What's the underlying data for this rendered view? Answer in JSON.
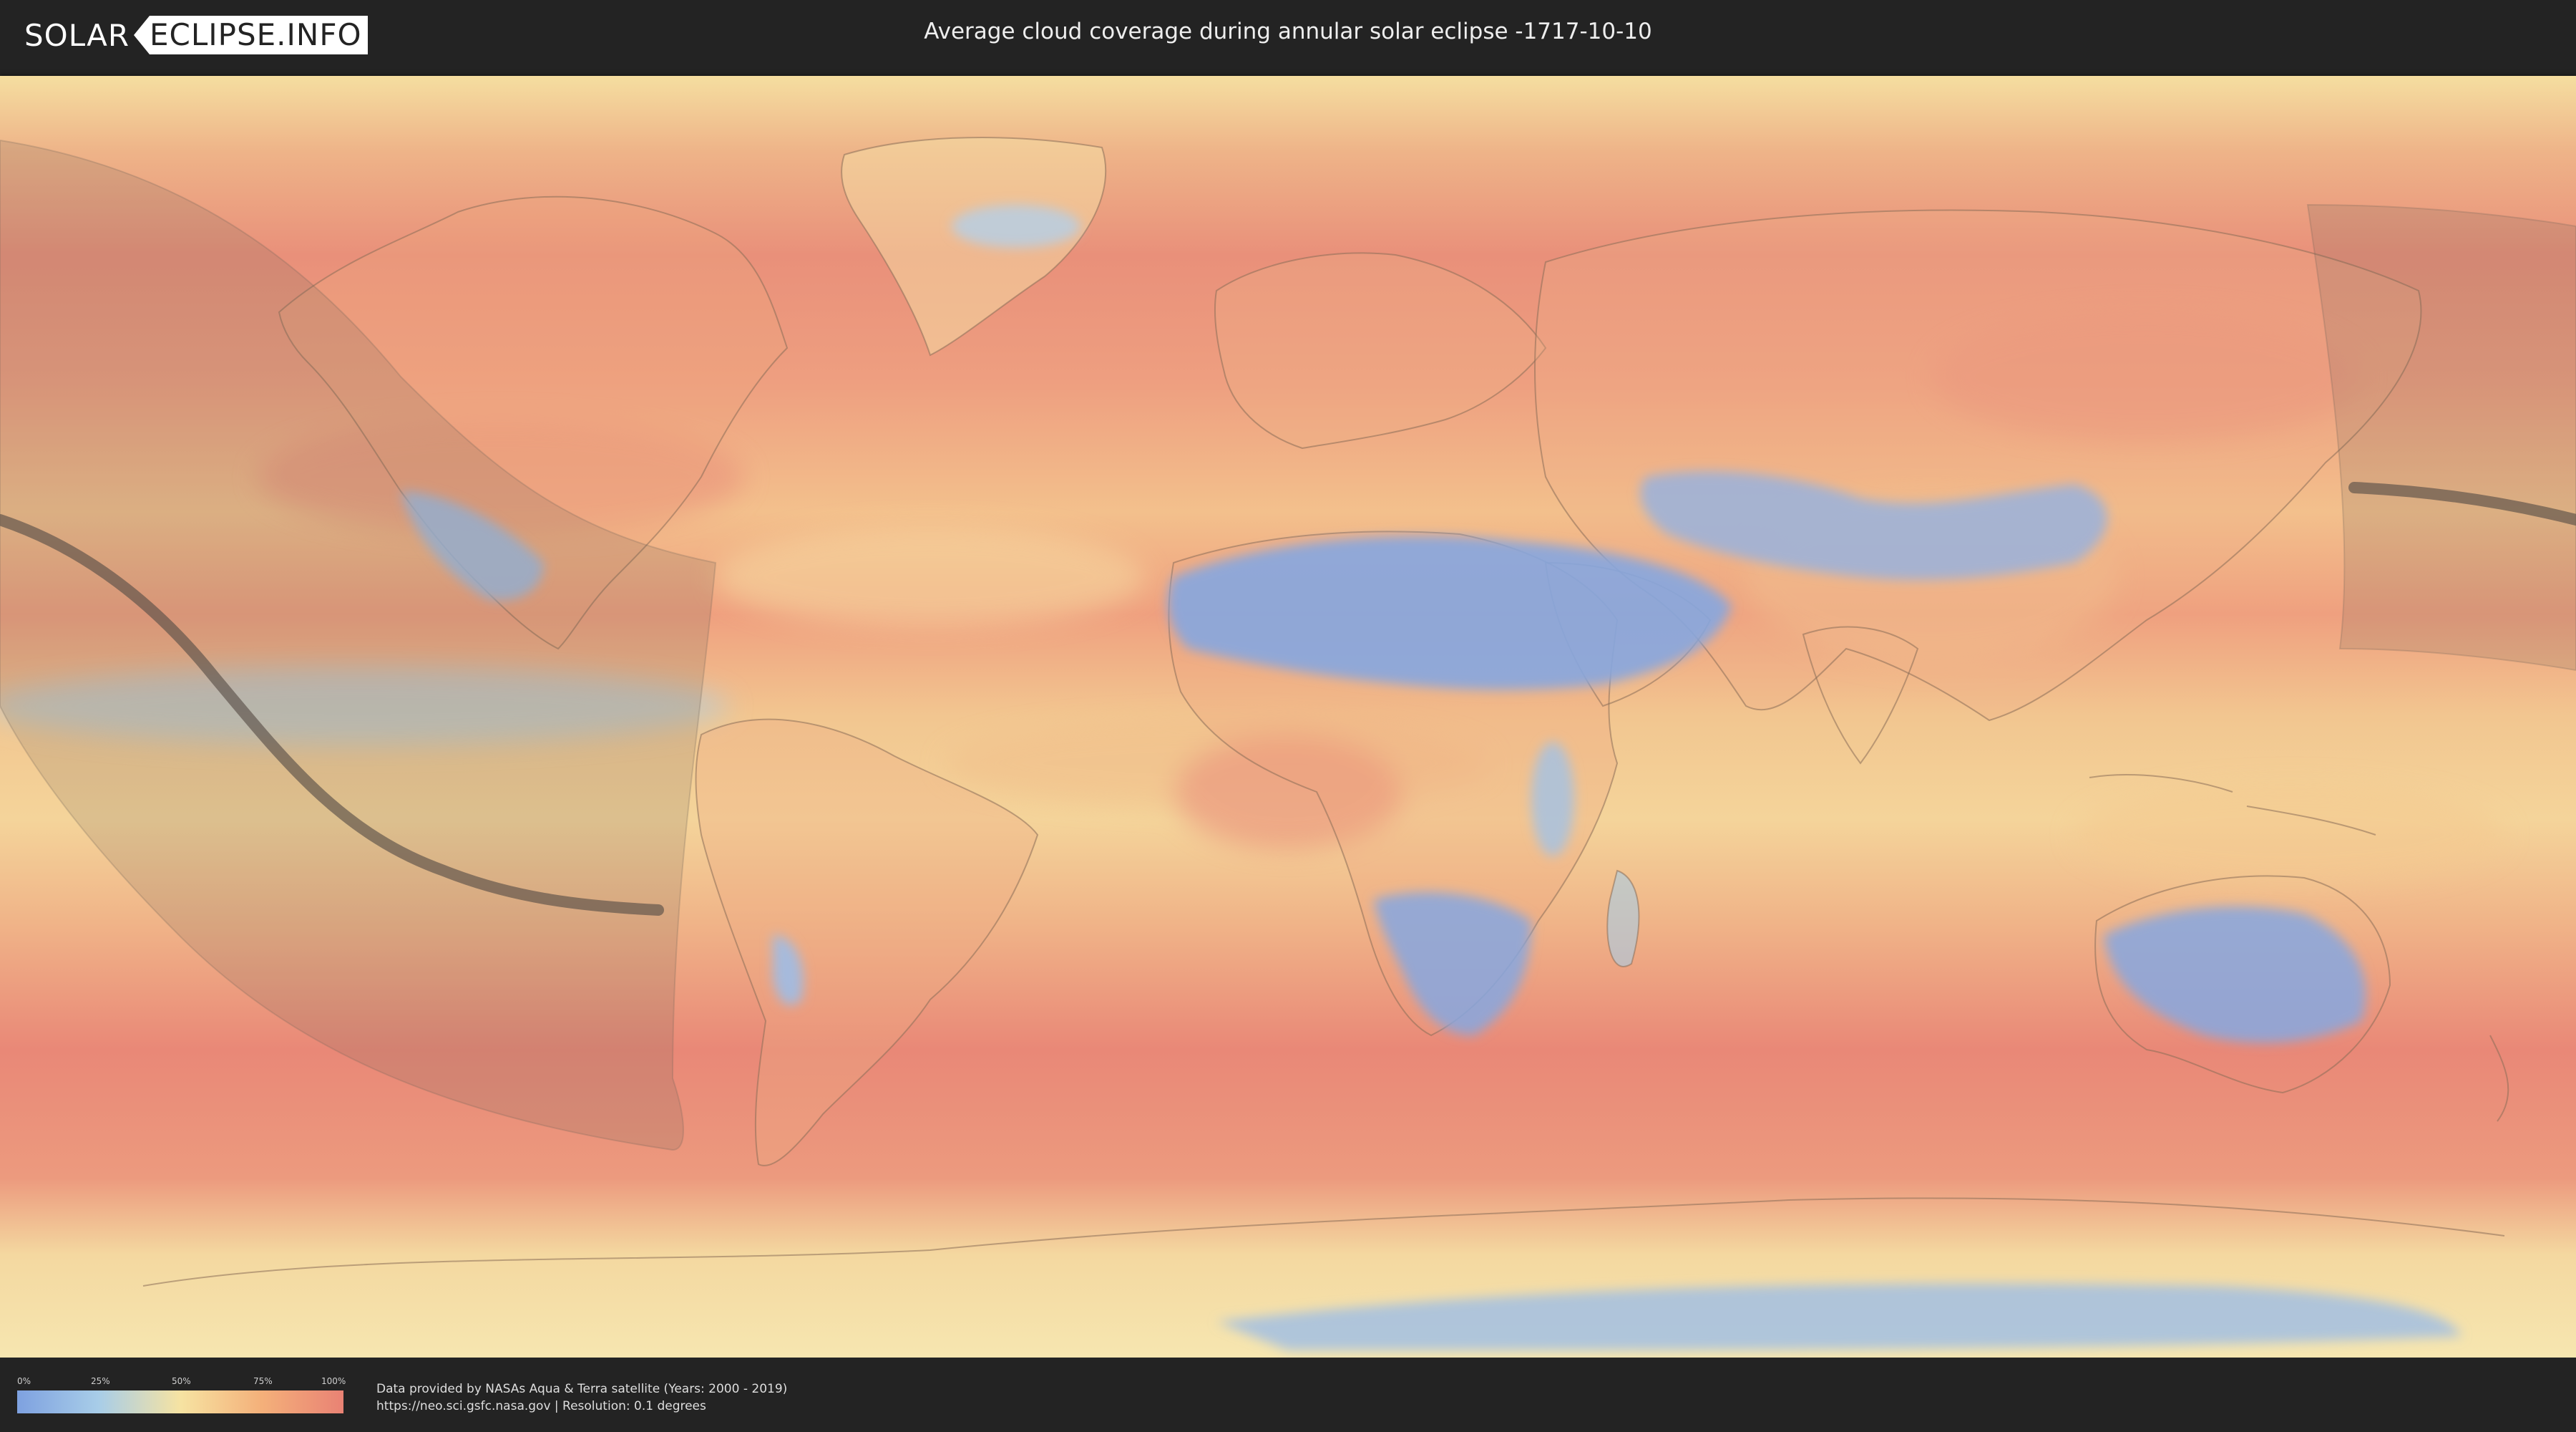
{
  "header": {
    "logo_part1": "SOLAR",
    "logo_part2": "ECLIPSE.INFO",
    "title": "Average cloud coverage during annular solar eclipse -1717-10-10"
  },
  "legend": {
    "ticks": [
      "0%",
      "25%",
      "50%",
      "75%",
      "100%"
    ],
    "colors": [
      "#7ea1e0",
      "#a8cde8",
      "#f6e3a2",
      "#f4b07a",
      "#e98274"
    ]
  },
  "footer": {
    "credit_line1": "Data provided by NASAs Aqua & Terra satellite (Years: 2000 - 2019)",
    "credit_line2": "https://neo.sci.gsfc.nasa.gov | Resolution: 0.1 degrees"
  },
  "map": {
    "projection": "equirectangular",
    "overlay": "annular eclipse path with penumbral visibility band",
    "clear_color": "#7ea1e0",
    "cloudy_color": "#e98274"
  }
}
